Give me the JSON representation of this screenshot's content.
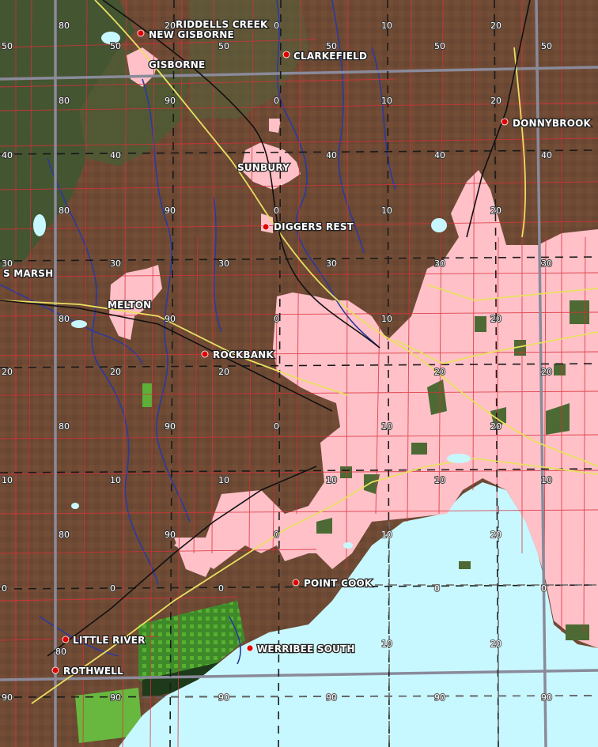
{
  "map": {
    "colors": {
      "land": "#6e4a34",
      "forest": "#3d5530",
      "urban": "#ffc0c8",
      "sea": "#c8f8ff",
      "roads": "#e0303a",
      "highways": "#e8e060",
      "rivers": "#2a3aa0",
      "railway": "#111111",
      "grid_major": "#8a8a9a",
      "town_dot": "#e00000"
    },
    "towns": [
      {
        "name": "RIDDELLS CREEK"
      },
      {
        "name": "NEW GISBORNE"
      },
      {
        "name": "GISBORNE"
      },
      {
        "name": "CLARKEFIELD"
      },
      {
        "name": "DONNYBROOK"
      },
      {
        "name": "SUNBURY"
      },
      {
        "name": "DIGGERS REST"
      },
      {
        "name": "S MARSH"
      },
      {
        "name": "MELTON"
      },
      {
        "name": "ROCKBANK"
      },
      {
        "name": "POINT COOK"
      },
      {
        "name": "LITTLE RIVER"
      },
      {
        "name": "WERRIBEE SOUTH"
      },
      {
        "name": "ROTHWELL"
      }
    ],
    "grid_labels": [
      "80",
      "50",
      "90",
      "0",
      "10",
      "20",
      "50",
      "40",
      "30",
      "20",
      "0",
      "80",
      "90",
      "10"
    ]
  }
}
